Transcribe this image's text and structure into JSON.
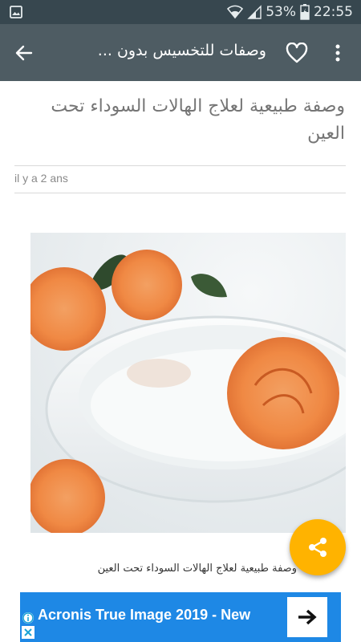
{
  "status_bar": {
    "battery_percent": "53%",
    "time": "22:55",
    "icons": [
      "gallery-icon",
      "wifi-icon",
      "signal-icon",
      "battery-icon"
    ]
  },
  "app_bar": {
    "title": "وصفات للتخسيس بدون ...",
    "icons": [
      "back-arrow-icon",
      "heart-icon",
      "more-vert-icon"
    ]
  },
  "article": {
    "headline": "وصفة طبيعية لعلاج الهالات السوداء تحت العين",
    "date": "il y a 2 ans",
    "image_caption": "وصفة طبيعية لعلاج الهالات السوداء تحت العين"
  },
  "fab": {
    "icon": "share-icon",
    "color": "#ffb300"
  },
  "ad": {
    "text": "Acronis True Image 2019 - New",
    "icons": [
      "ad-info-icon",
      "ad-close-icon",
      "arrow-right-icon"
    ],
    "color": "#1e88e5"
  }
}
